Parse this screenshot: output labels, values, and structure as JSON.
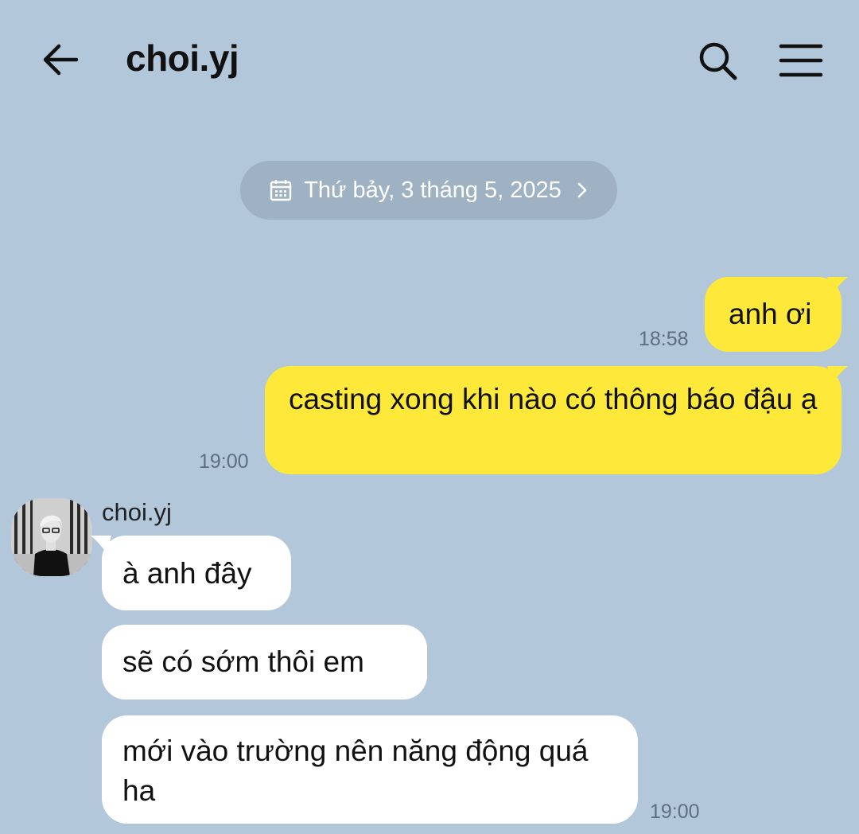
{
  "header": {
    "title": "choi.yj"
  },
  "date_pill": {
    "label": "Thứ bảy, 3 tháng 5, 2025"
  },
  "messages": [
    {
      "from": "me",
      "text": "anh ơi",
      "time": "18:58"
    },
    {
      "from": "me",
      "text": "casting xong khi nào có thông báo đậu ạ",
      "time": "19:00"
    },
    {
      "from": "them",
      "sender": "choi.yj",
      "text": "à anh đây"
    },
    {
      "from": "them",
      "text": "sẽ có sớm thôi em"
    },
    {
      "from": "them",
      "text": "mới vào trường nên năng động quá ha",
      "time": "19:00"
    }
  ],
  "colors": {
    "background": "#b2c7da",
    "my_bubble": "#fee83a",
    "their_bubble": "#ffffff",
    "date_pill": "#9fb2c3"
  },
  "icons": [
    "back-arrow-icon",
    "search-icon",
    "menu-icon",
    "calendar-icon",
    "chevron-right-icon"
  ]
}
